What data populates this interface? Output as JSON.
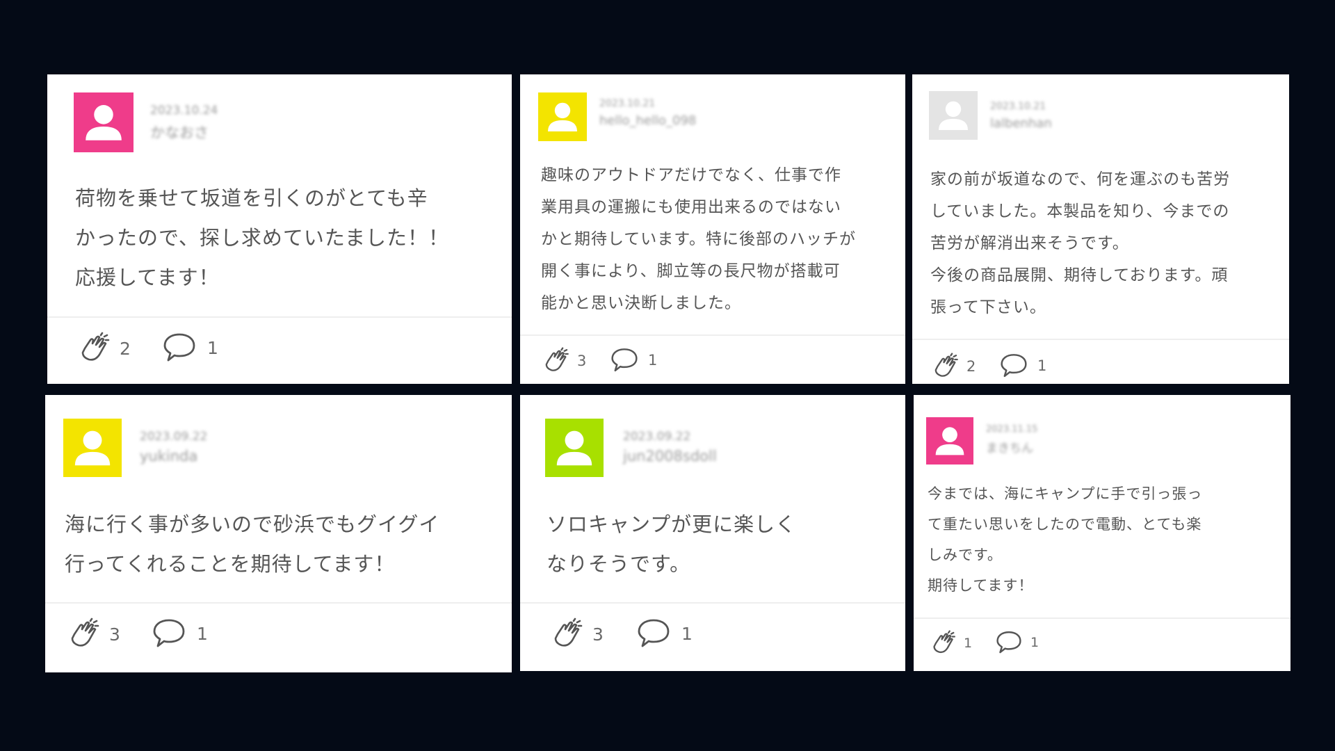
{
  "colors": {
    "background": "#040a16",
    "card": "#ffffff",
    "avatar_pink": "#ef3c8a",
    "avatar_yellow": "#f3e400",
    "avatar_lime": "#a8e000",
    "avatar_grey": "#e4e4e4"
  },
  "cards": [
    {
      "avatar_color": "#ef3c8a",
      "date": "2023.10.24",
      "username": "かなおさ",
      "text": "荷物を乗せて坂道を引くのがとても辛\nかったので、探し求めていたました！！\n応援してます！",
      "clap_icon": "clap-icon",
      "claps": "2",
      "comment_icon": "speech-bubble-icon",
      "comments": "1"
    },
    {
      "avatar_color": "#f3e400",
      "date": "2023.10.21",
      "username": "hello_hello_098",
      "text": "趣味のアウトドアだけでなく、仕事で作\n業用具の運搬にも使用出来るのではない\nかと期待しています。特に後部のハッチが\n開く事により、脚立等の長尺物が搭載可\n能かと思い決断しました。",
      "clap_icon": "clap-icon",
      "claps": "3",
      "comment_icon": "speech-bubble-icon",
      "comments": "1"
    },
    {
      "avatar_color": "#e4e4e4",
      "date": "2023.10.21",
      "username": "lalbenhan",
      "text": "家の前が坂道なので、何を運ぶのも苦労\nしていました。本製品を知り、今までの\n苦労が解消出来そうです。\n今後の商品展開、期待しております。頑\n張って下さい。",
      "clap_icon": "clap-icon",
      "claps": "2",
      "comment_icon": "speech-bubble-icon",
      "comments": "1"
    },
    {
      "avatar_color": "#f3e400",
      "date": "2023.09.22",
      "username": "yukinda",
      "text": "海に行く事が多いので砂浜でもグイグイ\n行ってくれることを期待してます！",
      "clap_icon": "clap-icon",
      "claps": "3",
      "comment_icon": "speech-bubble-icon",
      "comments": "1"
    },
    {
      "avatar_color": "#a8e000",
      "date": "2023.09.22",
      "username": "jun2008sdoll",
      "text": "ソロキャンプが更に楽しく\nなりそうです。",
      "clap_icon": "clap-icon",
      "claps": "3",
      "comment_icon": "speech-bubble-icon",
      "comments": "1"
    },
    {
      "avatar_color": "#ef3c8a",
      "date": "2023.11.15",
      "username": "まきちん",
      "text": "今までは、海にキャンプに手で引っ張っ\nて重たい思いをしたので電動、とても楽\nしみです。\n期待してます！",
      "clap_icon": "clap-icon",
      "claps": "1",
      "comment_icon": "speech-bubble-icon",
      "comments": "1"
    }
  ]
}
